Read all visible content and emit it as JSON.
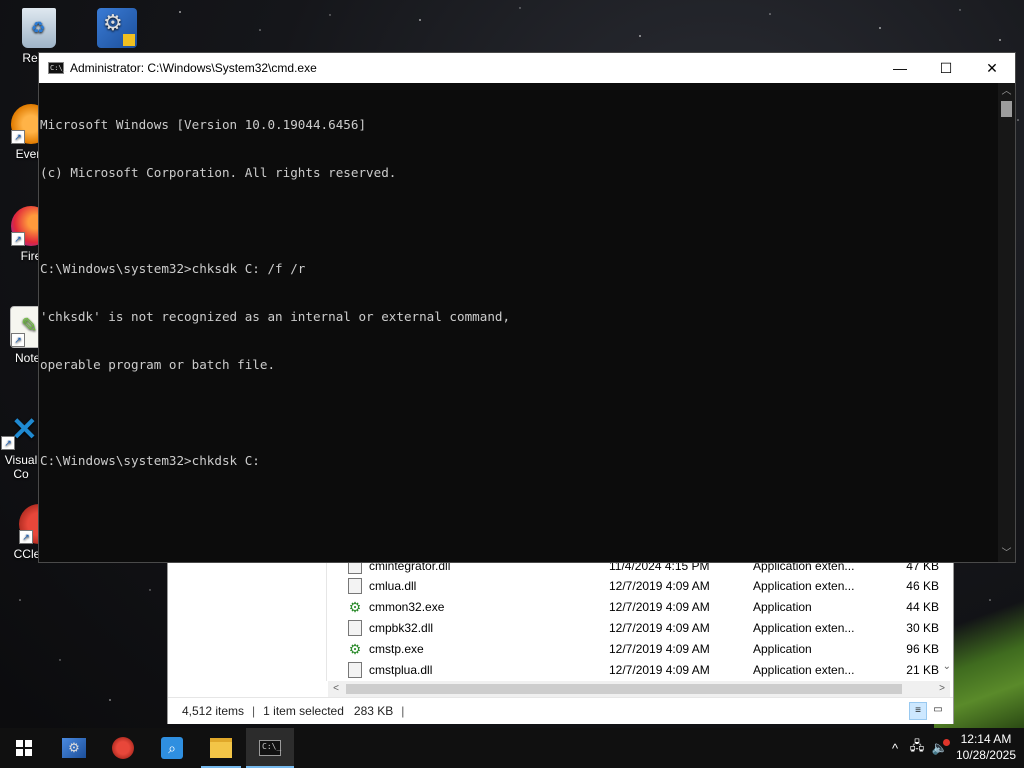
{
  "desktop": {
    "icons": [
      {
        "label": "Recyc",
        "icon": "recycle-bin-icon"
      },
      {
        "label": "",
        "icon": "control-panel-icon"
      },
      {
        "label": "Every",
        "icon": "everything-search-icon"
      },
      {
        "label": "Fire",
        "icon": "firefox-icon"
      },
      {
        "label": "Notep",
        "icon": "notepad-plus-plus-icon"
      },
      {
        "label": "Visual",
        "label2": "Co",
        "icon": "vscode-icon"
      },
      {
        "label": "CCleaner",
        "icon": "ccleaner-icon"
      }
    ]
  },
  "cmd": {
    "title": "Administrator: C:\\Windows\\System32\\cmd.exe",
    "icon_text": "C:\\_",
    "lines": [
      "Microsoft Windows [Version 10.0.19044.6456]",
      "(c) Microsoft Corporation. All rights reserved.",
      "",
      "C:\\Windows\\system32>chksdk C: /f /r",
      "'chksdk' is not recognized as an internal or external command,",
      "operable program or batch file.",
      "",
      "C:\\Windows\\system32>chkdsk C:"
    ],
    "minimize": "—",
    "maximize": "☐",
    "close": "✕"
  },
  "explorer": {
    "files": [
      {
        "name": "cmintegrator.dll",
        "date": "11/4/2024 4:15 PM",
        "type": "Application exten...",
        "size": "47 KB",
        "kind": "dll"
      },
      {
        "name": "cmlua.dll",
        "date": "12/7/2019 4:09 AM",
        "type": "Application exten...",
        "size": "46 KB",
        "kind": "dll"
      },
      {
        "name": "cmmon32.exe",
        "date": "12/7/2019 4:09 AM",
        "type": "Application",
        "size": "44 KB",
        "kind": "exe"
      },
      {
        "name": "cmpbk32.dll",
        "date": "12/7/2019 4:09 AM",
        "type": "Application exten...",
        "size": "30 KB",
        "kind": "dll"
      },
      {
        "name": "cmstp.exe",
        "date": "12/7/2019 4:09 AM",
        "type": "Application",
        "size": "96 KB",
        "kind": "exe"
      },
      {
        "name": "cmstplua.dll",
        "date": "12/7/2019 4:09 AM",
        "type": "Application exten...",
        "size": "21 KB",
        "kind": "dll"
      }
    ],
    "status": {
      "items": "4,512 items",
      "selected": "1 item selected",
      "size": "283 KB",
      "sep": "|"
    }
  },
  "taskbar": {
    "start": "start-icon",
    "apps": [
      "control-panel-icon",
      "ccleaner-icon",
      "magnifier-icon",
      "file-explorer-icon",
      "cmd-icon"
    ],
    "time": "12:14 AM",
    "date": "10/28/2025",
    "chevron": "^"
  }
}
